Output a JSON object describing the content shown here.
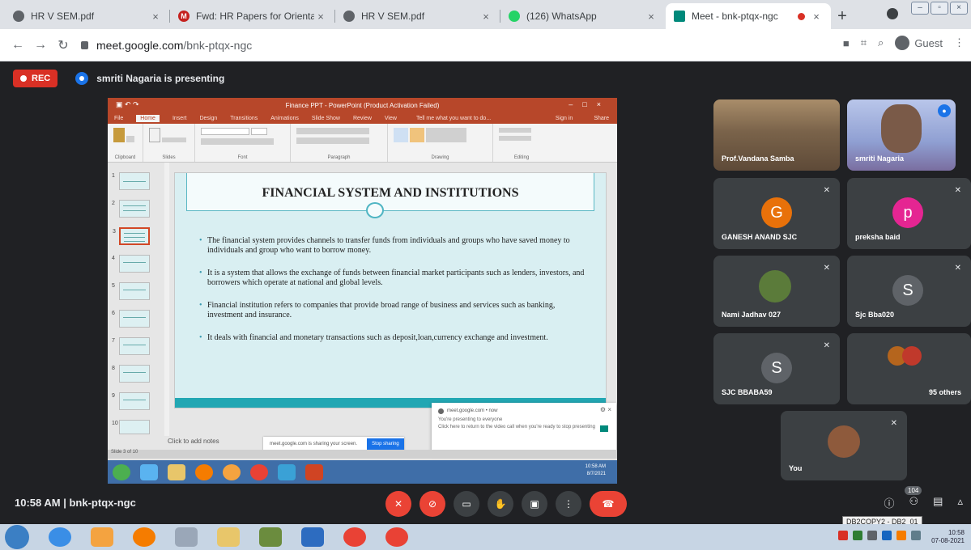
{
  "browser": {
    "tabs": [
      {
        "title": "HR V SEM.pdf",
        "fav_color": "#5f6368",
        "active": false
      },
      {
        "title": "Fwd: HR Papers for Orientation",
        "fav_color": "#c5221f",
        "active": false
      },
      {
        "title": "HR V SEM.pdf",
        "fav_color": "#5f6368",
        "active": false
      },
      {
        "title": "(126) WhatsApp",
        "fav_color": "#25d366",
        "active": false
      },
      {
        "title": "Meet - bnk-ptqx-ngc",
        "fav_color": "#00897b",
        "active": true
      }
    ],
    "new_tab": "+",
    "url_host": "meet.google.com",
    "url_path": "/bnk-ptqx-ngc",
    "profile": "Guest"
  },
  "meet": {
    "rec_label": "REC",
    "presenting_text": "smriti Nagaria is presenting",
    "meeting_time": "10:58 AM",
    "meeting_code": "bnk-ptqx-ngc",
    "participants_count": "104",
    "tooltip": "DB2COPY2 - DB2_01",
    "tiles": [
      {
        "name": "Prof.Vandana Samba",
        "kind": "video"
      },
      {
        "name": "smriti Nagaria",
        "kind": "video"
      },
      {
        "name": "GANESH ANAND SJC",
        "letter": "G",
        "color": "#e8710a"
      },
      {
        "name": "preksha baid",
        "letter": "p",
        "color": "#e52592"
      },
      {
        "name": "Nami Jadhav 027",
        "kind": "photo"
      },
      {
        "name": "Sjc Bba020",
        "letter": "S",
        "color": "#5f6368"
      },
      {
        "name": "SJC BBABA59",
        "letter": "S",
        "color": "#5f6368"
      },
      {
        "name": "95 others",
        "kind": "group"
      },
      {
        "name": "You",
        "kind": "photo"
      }
    ]
  },
  "powerpoint": {
    "title_bar": "Finance PPT - PowerPoint (Product Activation Failed)",
    "menu": [
      "File",
      "Home",
      "Insert",
      "Design",
      "Transitions",
      "Animations",
      "Slide Show",
      "Review",
      "View"
    ],
    "tell_me": "Tell me what you want to do...",
    "sign_in": "Sign in",
    "share": "Share",
    "ribbon_groups": [
      "Clipboard",
      "Slides",
      "Font",
      "Paragraph",
      "Drawing",
      "Editing"
    ],
    "slide_title": "FINANCIAL SYSTEM AND INSTITUTIONS",
    "bullets": [
      "The financial system provides channels to transfer funds from individuals and groups who have saved money to individuals and group who want to borrow money.",
      "It is a system that allows the exchange of funds between financial market participants such as lenders, investors, and borrowers which operate at national and global levels.",
      "Financial institution refers to companies that provide broad range of business and services such as banking, investment and insurance.",
      "It deals with financial and monetary transactions such as deposit,loan,currency exchange and investment."
    ],
    "notes_placeholder": "Click to add notes",
    "status": "Slide 3 of 10",
    "thumb_numbers": [
      "1",
      "2",
      "3",
      "4",
      "5",
      "6",
      "7",
      "8",
      "9",
      "10"
    ]
  },
  "share_bar": {
    "text": "meet.google.com is sharing your screen.",
    "stop_label": "Stop sharing"
  },
  "toast": {
    "source": "meet.google.com • now",
    "line1": "You're presenting to everyone",
    "line2": "Click here to return to the video call when you're ready to stop presenting"
  },
  "inner_clock": {
    "time": "10:58 AM",
    "date": "8/7/2021"
  },
  "system_clock": {
    "time": "10:58",
    "date": "07-08-2021"
  }
}
